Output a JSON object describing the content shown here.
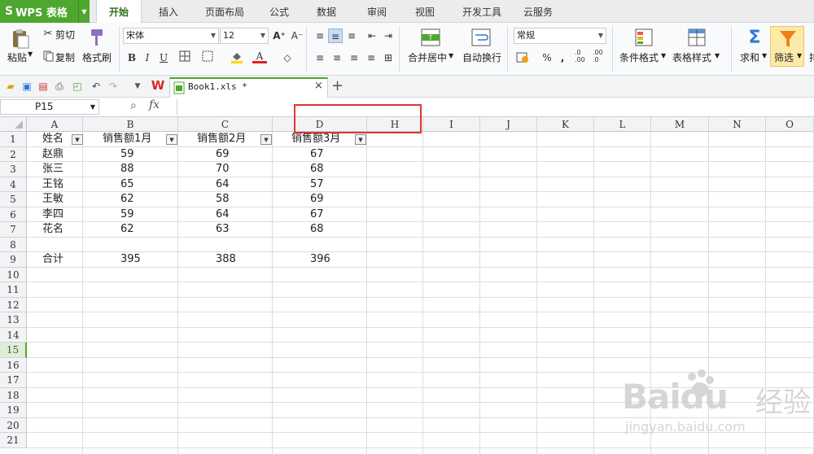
{
  "app": {
    "name": "WPS 表格",
    "logo_glyph": "S"
  },
  "menu_tabs": [
    {
      "label": "开始",
      "active": true
    },
    {
      "label": "插入"
    },
    {
      "label": "页面布局"
    },
    {
      "label": "公式"
    },
    {
      "label": "数据"
    },
    {
      "label": "审阅"
    },
    {
      "label": "视图"
    },
    {
      "label": "开发工具"
    },
    {
      "label": "云服务"
    }
  ],
  "ribbon": {
    "paste": "粘贴",
    "cut": "剪切",
    "copy": "复制",
    "format_painter": "格式刷",
    "font_name": "宋体",
    "font_size": "12",
    "bold": "B",
    "italic": "I",
    "underline": "U",
    "merge_center": "合并居中",
    "wrap_text": "自动换行",
    "number_format": "常规",
    "percent": "%",
    "thousands": "٫",
    "inc_decimal": ".00\n+.0",
    "dec_decimal": ".00\n→.0",
    "conditional_format": "条件格式",
    "table_style": "表格样式",
    "sum": "求和",
    "filter": "筛选",
    "sort_partial": "排"
  },
  "document": {
    "tab_title": "Book1.xls *"
  },
  "formula_bar": {
    "name_box": "P15",
    "fx": "fx",
    "zoom_icon": "magnifier-icon"
  },
  "sheet": {
    "columns": [
      "A",
      "B",
      "C",
      "D",
      "H",
      "I",
      "J",
      "K",
      "L",
      "M",
      "N",
      "O"
    ],
    "rows": [
      "1",
      "2",
      "3",
      "4",
      "5",
      "6",
      "7",
      "8",
      "9",
      "10",
      "11",
      "12",
      "13",
      "14",
      "15",
      "16",
      "17",
      "18",
      "19",
      "20",
      "21"
    ],
    "active_row": "15",
    "headers": [
      "姓名",
      "销售额1月",
      "销售额2月",
      "销售额3月"
    ],
    "data": [
      [
        "赵鼎",
        "59",
        "69",
        "67"
      ],
      [
        "张三",
        "88",
        "70",
        "68"
      ],
      [
        "王铭",
        "65",
        "64",
        "57"
      ],
      [
        "王敏",
        "62",
        "58",
        "69"
      ],
      [
        "李四",
        "59",
        "64",
        "67"
      ],
      [
        "花名",
        "62",
        "63",
        "68"
      ]
    ],
    "total": [
      "合计",
      "395",
      "388",
      "396"
    ]
  },
  "watermark": {
    "brand": "Baidu",
    "cn": "经验",
    "url": "jingyan.baidu.com"
  },
  "colors": {
    "accent": "#4ea72e",
    "highlight_box": "#e53333",
    "active_row": "#2d6e18"
  }
}
